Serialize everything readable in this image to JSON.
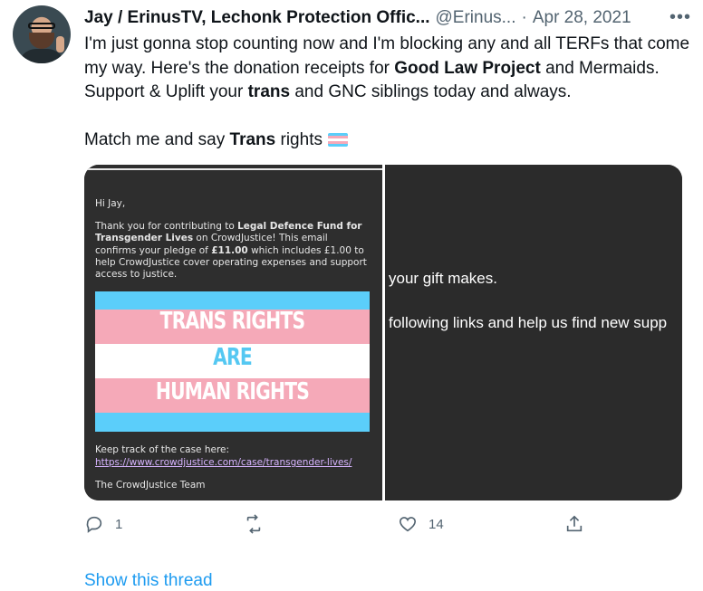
{
  "author": {
    "name": "Jay / ErinusTV, Lechonk Protection Offic...",
    "handle": "@Erinus...",
    "separator": "·",
    "date": "Apr 28, 2021",
    "more": "•••"
  },
  "tweet": {
    "p1_a": "I'm just gonna stop counting now and I'm blocking any and all TERFs that come my way. Here's the donation receipts for ",
    "p1_b": "Good Law Project",
    "p1_c": " and Mermaids. Support & Uplift your ",
    "p1_d": "trans",
    "p1_e": " and GNC siblings today and always.",
    "p2_a": "Match me and say ",
    "p2_b": "Trans",
    "p2_c": " rights"
  },
  "email": {
    "greeting": "Hi Jay,",
    "body_a": "Thank you for contributing to ",
    "body_b": "Legal Defence Fund for Transgender Lives",
    "body_c": " on CrowdJustice! This email confirms your pledge of ",
    "body_d": "£11.00",
    "body_e": " which includes £1.00 to help CrowdJustice cover operating expenses and support access to justice.",
    "banner_line1": "TRANS RIGHTS",
    "banner_line2": "ARE",
    "banner_line3": "HUMAN RIGHTS",
    "track_label": "Keep track of the case here:",
    "track_link": "https://www.crowdjustice.com/case/transgender-lives/",
    "signoff": "The CrowdJustice Team",
    "right_line1": "your gift makes.",
    "right_line2": "following links and help us find new supp"
  },
  "colors": {
    "trans_blue": "#5bcefa",
    "trans_pink": "#f5a9b8",
    "trans_white": "#ffffff",
    "banner_blue_text": "#55c8f2",
    "link": "#1d9bf0"
  },
  "actions": {
    "reply_icon": "reply-icon",
    "reply_count": "1",
    "retweet_icon": "retweet-icon",
    "retweet_count": "",
    "like_icon": "heart-icon",
    "like_count": "14",
    "share_icon": "share-icon"
  },
  "show_thread": "Show this thread"
}
